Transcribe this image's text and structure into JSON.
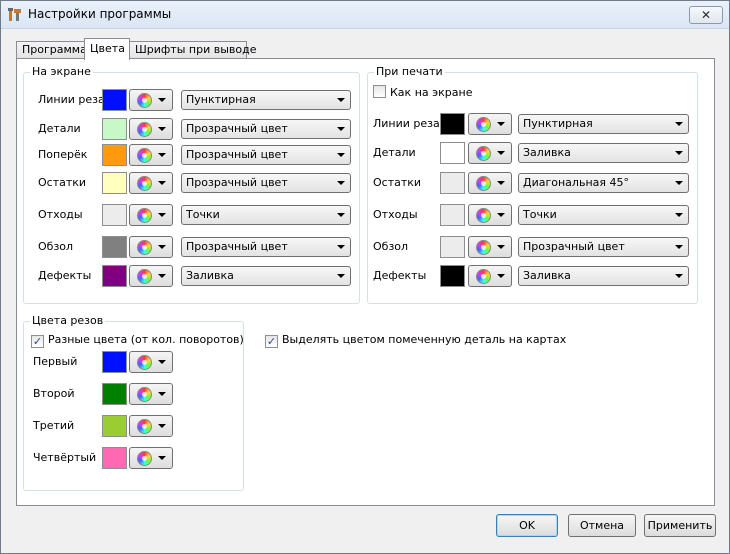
{
  "window": {
    "title": "Настройки программы",
    "close_glyph": "✕"
  },
  "tabs": [
    "Программа",
    "Цвета",
    "Шрифты при выводе"
  ],
  "screen_group": {
    "title": "На экране",
    "rows": [
      {
        "label": "Линии реза",
        "color": "#0010ff",
        "style": "Пунктирная"
      },
      {
        "label": "Детали",
        "color": "#c8f8c8",
        "style": "Прозрачный цвет"
      },
      {
        "label": "Поперёк",
        "color": "#ff9a10",
        "style": "Прозрачный цвет"
      },
      {
        "label": "Остатки",
        "color": "#ffffc0",
        "style": "Прозрачный цвет"
      },
      {
        "label": "Отходы",
        "color": "#ececec",
        "style": "Точки"
      },
      {
        "label": "Обзол",
        "color": "#808080",
        "style": "Прозрачный цвет"
      },
      {
        "label": "Дефекты",
        "color": "#800080",
        "style": "Заливка"
      }
    ]
  },
  "print_group": {
    "title": "При печати",
    "same_as_screen_label": "Как на экране",
    "same_as_screen_checked": false,
    "rows": [
      {
        "label": "Линии реза",
        "color": "#000000",
        "style": "Пунктирная"
      },
      {
        "label": "Детали",
        "color": "#ffffff",
        "style": "Заливка"
      },
      {
        "label": "Остатки",
        "color": "#ececec",
        "style": "Диагональная 45°"
      },
      {
        "label": "Отходы",
        "color": "#ececec",
        "style": "Точки"
      },
      {
        "label": "Обзол",
        "color": "#ececec",
        "style": "Прозрачный цвет"
      },
      {
        "label": "Дефекты",
        "color": "#000000",
        "style": "Заливка"
      }
    ]
  },
  "cut_colors_group": {
    "title": "Цвета резов",
    "different_colors_label": "Разные цвета (от кол. поворотов)",
    "different_colors_checked": true,
    "rows": [
      {
        "label": "Первый",
        "color": "#0010ff"
      },
      {
        "label": "Второй",
        "color": "#008000"
      },
      {
        "label": "Третий",
        "color": "#9acd32"
      },
      {
        "label": "Четвёртый",
        "color": "#ff69b4"
      }
    ]
  },
  "highlight_checkbox": {
    "label": "Выделять цветом помеченную деталь на картах",
    "checked": true
  },
  "buttons": {
    "ok": "OK",
    "cancel": "Отмена",
    "apply": "Применить"
  },
  "icons": {
    "app": "settings-tools-icon",
    "color_picker": "color-wheel-icon",
    "dropdown": "chevron-down-icon",
    "check": "check-icon"
  }
}
